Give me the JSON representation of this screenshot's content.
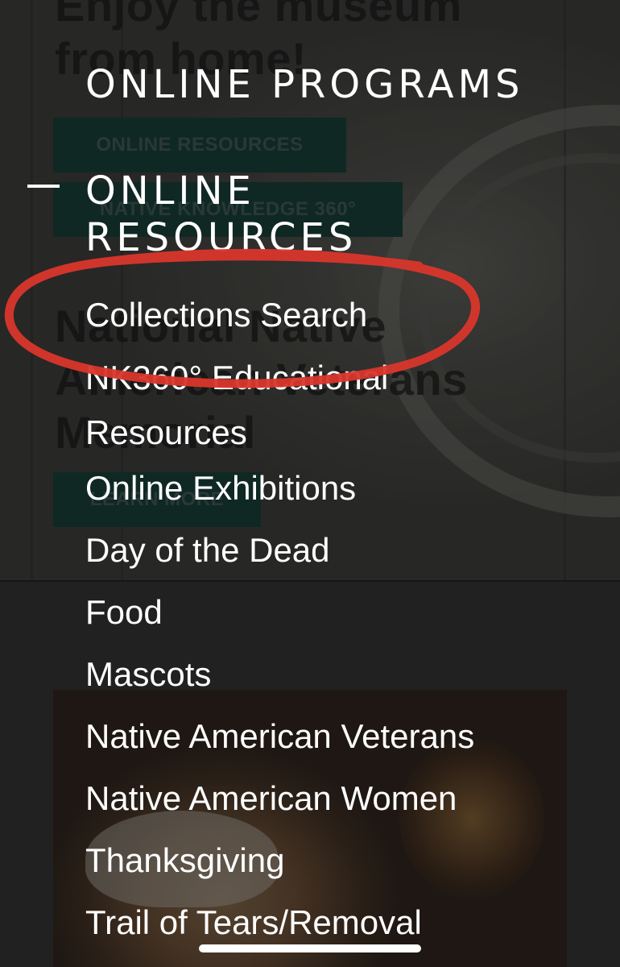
{
  "background": {
    "heading_1": "Enjoy the museum from home!",
    "button_1": "ONLINE RESOURCES",
    "button_2": "NATIVE KNOWLEDGE 360°",
    "heading_2": "National Native American Veterans Memorial",
    "button_3": "LEARN MORE"
  },
  "menu": {
    "online_programs": "ONLINE PROGRAMS",
    "online_resources": "ONLINE RESOURCES",
    "items": [
      {
        "label": "Collections Search"
      },
      {
        "label": "NK360° Educational Resources"
      },
      {
        "label": "Online Exhibitions"
      },
      {
        "label": "Day of the Dead"
      },
      {
        "label": "Food"
      },
      {
        "label": "Mascots"
      },
      {
        "label": "Native American Veterans"
      },
      {
        "label": "Native American Women"
      },
      {
        "label": "Thanksgiving"
      },
      {
        "label": "Trail of Tears/Removal"
      }
    ]
  },
  "icons": {
    "collapse": "minus-icon"
  },
  "colors": {
    "annotation": "#d9362b",
    "menu_text": "#ffffff",
    "background_button": "#0e3b33"
  }
}
